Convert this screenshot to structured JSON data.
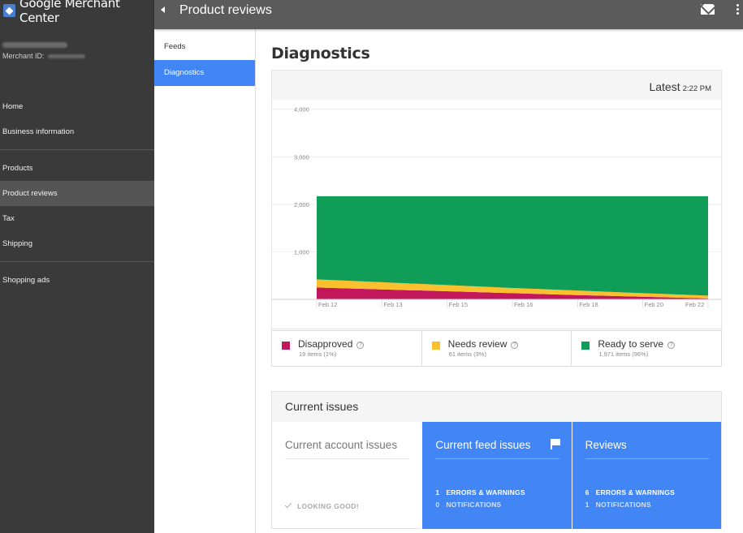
{
  "app": {
    "brand": "Google Merchant Center",
    "page_title": "Product reviews"
  },
  "account": {
    "merchant_label": "Merchant ID:"
  },
  "sidebar": {
    "items": [
      "Home",
      "Business information",
      "Products",
      "Product reviews",
      "Tax",
      "Shipping",
      "Shopping ads"
    ],
    "active": "Product reviews"
  },
  "subnav": {
    "items": [
      "Feeds",
      "Diagnostics"
    ],
    "active": "Diagnostics"
  },
  "diagnostics": {
    "title": "Diagnostics",
    "latest_label": "Latest",
    "latest_time": "2:22 PM"
  },
  "chart_data": {
    "type": "area",
    "stacked": true,
    "x": [
      "Feb 12",
      "Feb 13",
      "Feb 15",
      "Feb 16",
      "Feb 18",
      "Feb 20",
      "Feb 22"
    ],
    "series": [
      {
        "name": "Disapproved",
        "color": "#c2185b",
        "values": [
          250,
          210,
          170,
          130,
          90,
          55,
          19
        ]
      },
      {
        "name": "Needs review",
        "color": "#fbc02d",
        "values": [
          170,
          150,
          130,
          110,
          95,
          75,
          61
        ]
      },
      {
        "name": "Ready to serve",
        "color": "#0f9d58",
        "values": [
          1751,
          1811,
          1871,
          1931,
          1986,
          2041,
          2091
        ]
      }
    ],
    "yticks": [
      "4,000",
      "3,000",
      "2,000",
      "1,000"
    ],
    "ylim": [
      0,
      4200
    ],
    "grid": true
  },
  "legend": [
    {
      "label": "Disapproved",
      "sub": "19 items (1%)",
      "color": "#c2185b"
    },
    {
      "label": "Needs review",
      "sub": "61 items (3%)",
      "color": "#fbc02d"
    },
    {
      "label": "Ready to serve",
      "sub": "1,971 items (96%)",
      "color": "#0f9d58"
    }
  ],
  "issues": {
    "title": "Current issues",
    "account": {
      "title": "Current account issues",
      "status": "LOOKING GOOD!"
    },
    "feed": {
      "title": "Current feed issues",
      "errors_count": "1",
      "errors_label": "ERRORS & WARNINGS",
      "notif_count": "0",
      "notif_label": "NOTIFICATIONS"
    },
    "reviews": {
      "title": "Reviews",
      "errors_count": "6",
      "errors_label": "ERRORS & WARNINGS",
      "notif_count": "1",
      "notif_label": "NOTIFICATIONS"
    }
  }
}
